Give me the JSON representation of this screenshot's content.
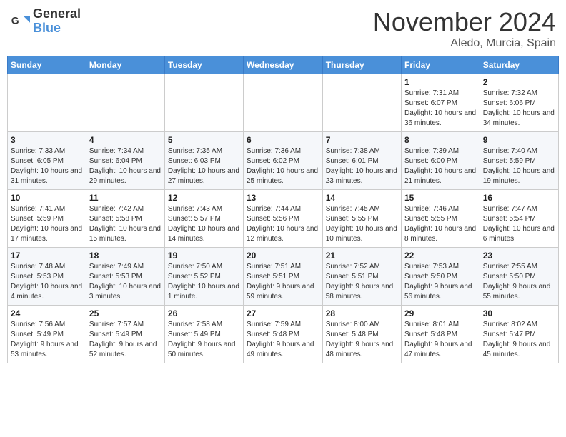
{
  "header": {
    "logo_general": "General",
    "logo_blue": "Blue",
    "month_title": "November 2024",
    "location": "Aledo, Murcia, Spain"
  },
  "days_of_week": [
    "Sunday",
    "Monday",
    "Tuesday",
    "Wednesday",
    "Thursday",
    "Friday",
    "Saturday"
  ],
  "weeks": [
    [
      {
        "day": "",
        "info": ""
      },
      {
        "day": "",
        "info": ""
      },
      {
        "day": "",
        "info": ""
      },
      {
        "day": "",
        "info": ""
      },
      {
        "day": "",
        "info": ""
      },
      {
        "day": "1",
        "info": "Sunrise: 7:31 AM\nSunset: 6:07 PM\nDaylight: 10 hours and 36 minutes."
      },
      {
        "day": "2",
        "info": "Sunrise: 7:32 AM\nSunset: 6:06 PM\nDaylight: 10 hours and 34 minutes."
      }
    ],
    [
      {
        "day": "3",
        "info": "Sunrise: 7:33 AM\nSunset: 6:05 PM\nDaylight: 10 hours and 31 minutes."
      },
      {
        "day": "4",
        "info": "Sunrise: 7:34 AM\nSunset: 6:04 PM\nDaylight: 10 hours and 29 minutes."
      },
      {
        "day": "5",
        "info": "Sunrise: 7:35 AM\nSunset: 6:03 PM\nDaylight: 10 hours and 27 minutes."
      },
      {
        "day": "6",
        "info": "Sunrise: 7:36 AM\nSunset: 6:02 PM\nDaylight: 10 hours and 25 minutes."
      },
      {
        "day": "7",
        "info": "Sunrise: 7:38 AM\nSunset: 6:01 PM\nDaylight: 10 hours and 23 minutes."
      },
      {
        "day": "8",
        "info": "Sunrise: 7:39 AM\nSunset: 6:00 PM\nDaylight: 10 hours and 21 minutes."
      },
      {
        "day": "9",
        "info": "Sunrise: 7:40 AM\nSunset: 5:59 PM\nDaylight: 10 hours and 19 minutes."
      }
    ],
    [
      {
        "day": "10",
        "info": "Sunrise: 7:41 AM\nSunset: 5:59 PM\nDaylight: 10 hours and 17 minutes."
      },
      {
        "day": "11",
        "info": "Sunrise: 7:42 AM\nSunset: 5:58 PM\nDaylight: 10 hours and 15 minutes."
      },
      {
        "day": "12",
        "info": "Sunrise: 7:43 AM\nSunset: 5:57 PM\nDaylight: 10 hours and 14 minutes."
      },
      {
        "day": "13",
        "info": "Sunrise: 7:44 AM\nSunset: 5:56 PM\nDaylight: 10 hours and 12 minutes."
      },
      {
        "day": "14",
        "info": "Sunrise: 7:45 AM\nSunset: 5:55 PM\nDaylight: 10 hours and 10 minutes."
      },
      {
        "day": "15",
        "info": "Sunrise: 7:46 AM\nSunset: 5:55 PM\nDaylight: 10 hours and 8 minutes."
      },
      {
        "day": "16",
        "info": "Sunrise: 7:47 AM\nSunset: 5:54 PM\nDaylight: 10 hours and 6 minutes."
      }
    ],
    [
      {
        "day": "17",
        "info": "Sunrise: 7:48 AM\nSunset: 5:53 PM\nDaylight: 10 hours and 4 minutes."
      },
      {
        "day": "18",
        "info": "Sunrise: 7:49 AM\nSunset: 5:53 PM\nDaylight: 10 hours and 3 minutes."
      },
      {
        "day": "19",
        "info": "Sunrise: 7:50 AM\nSunset: 5:52 PM\nDaylight: 10 hours and 1 minute."
      },
      {
        "day": "20",
        "info": "Sunrise: 7:51 AM\nSunset: 5:51 PM\nDaylight: 9 hours and 59 minutes."
      },
      {
        "day": "21",
        "info": "Sunrise: 7:52 AM\nSunset: 5:51 PM\nDaylight: 9 hours and 58 minutes."
      },
      {
        "day": "22",
        "info": "Sunrise: 7:53 AM\nSunset: 5:50 PM\nDaylight: 9 hours and 56 minutes."
      },
      {
        "day": "23",
        "info": "Sunrise: 7:55 AM\nSunset: 5:50 PM\nDaylight: 9 hours and 55 minutes."
      }
    ],
    [
      {
        "day": "24",
        "info": "Sunrise: 7:56 AM\nSunset: 5:49 PM\nDaylight: 9 hours and 53 minutes."
      },
      {
        "day": "25",
        "info": "Sunrise: 7:57 AM\nSunset: 5:49 PM\nDaylight: 9 hours and 52 minutes."
      },
      {
        "day": "26",
        "info": "Sunrise: 7:58 AM\nSunset: 5:49 PM\nDaylight: 9 hours and 50 minutes."
      },
      {
        "day": "27",
        "info": "Sunrise: 7:59 AM\nSunset: 5:48 PM\nDaylight: 9 hours and 49 minutes."
      },
      {
        "day": "28",
        "info": "Sunrise: 8:00 AM\nSunset: 5:48 PM\nDaylight: 9 hours and 48 minutes."
      },
      {
        "day": "29",
        "info": "Sunrise: 8:01 AM\nSunset: 5:48 PM\nDaylight: 9 hours and 47 minutes."
      },
      {
        "day": "30",
        "info": "Sunrise: 8:02 AM\nSunset: 5:47 PM\nDaylight: 9 hours and 45 minutes."
      }
    ]
  ]
}
